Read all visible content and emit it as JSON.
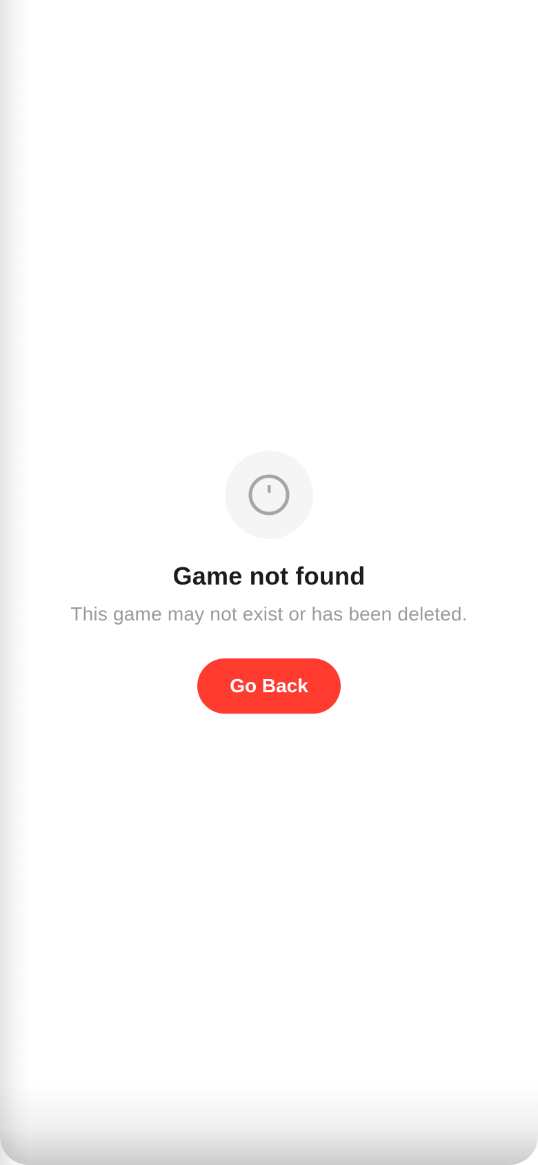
{
  "error_state": {
    "icon": "alert-circle-icon",
    "title": "Game not found",
    "message": "This game may not exist or has been deleted.",
    "button_label": "Go Back"
  },
  "colors": {
    "accent": "#ff3b30",
    "title": "#1c1c1c",
    "message": "#9a9a9a",
    "icon": "#a6a6a6",
    "icon_background": "#f5f5f5",
    "background": "#ffffff"
  }
}
